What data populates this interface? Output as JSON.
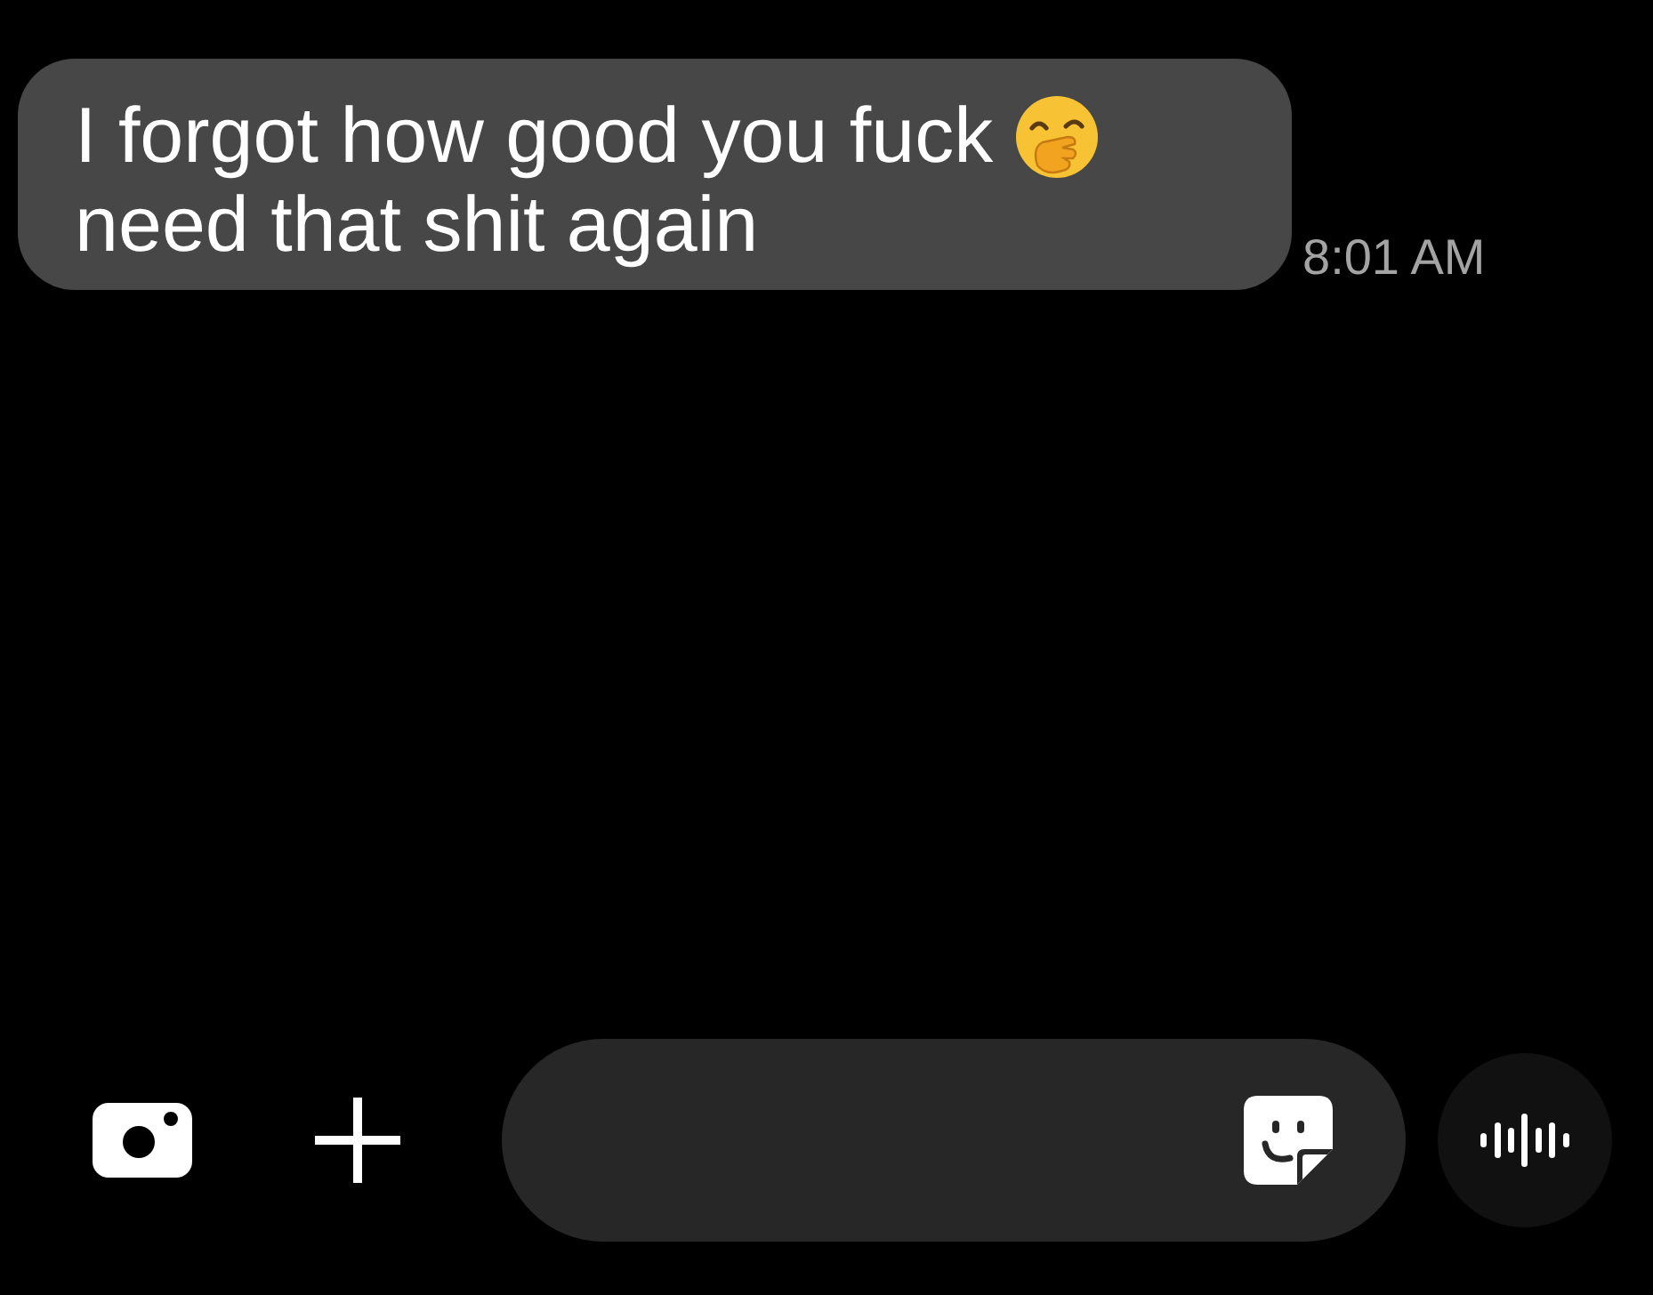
{
  "message": {
    "lines": [
      "I forgot how good you fuck",
      "need that shit again"
    ],
    "time": "8:01 AM"
  }
}
